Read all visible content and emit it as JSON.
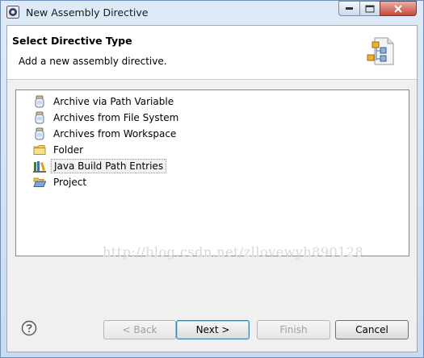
{
  "window": {
    "title": "New Assembly Directive"
  },
  "header": {
    "title": "Select Directive Type",
    "description": "Add a new assembly directive."
  },
  "list": {
    "items": [
      {
        "label": "Archive via Path Variable",
        "icon": "jar-icon"
      },
      {
        "label": "Archives from File System",
        "icon": "jar-icon"
      },
      {
        "label": "Archives from Workspace",
        "icon": "jar-icon"
      },
      {
        "label": "Folder",
        "icon": "folder-icon"
      },
      {
        "label": "Java Build Path Entries",
        "icon": "library-icon",
        "selected": true
      },
      {
        "label": "Project",
        "icon": "open-folder-icon"
      }
    ]
  },
  "watermark": "http://blog.csdn.net/zllovewyh890128",
  "buttons": {
    "back": "< Back",
    "next": "Next >",
    "finish": "Finish",
    "cancel": "Cancel"
  },
  "colors": {
    "accent": "#3c7fb1",
    "close_button": "#c7493a",
    "titlebar": "#dfeaf7"
  }
}
